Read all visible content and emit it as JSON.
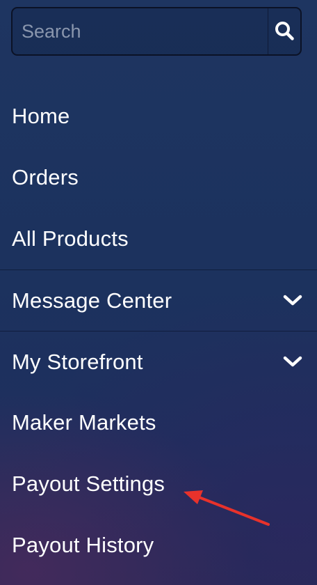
{
  "search": {
    "placeholder": "Search",
    "icon": "search-icon"
  },
  "nav": {
    "items": [
      {
        "label": "Home"
      },
      {
        "label": "Orders"
      },
      {
        "label": "All Products"
      },
      {
        "label": "Message Center",
        "icon": "chevron-down-icon"
      },
      {
        "label": "My Storefront",
        "icon": "chevron-down-icon"
      },
      {
        "label": "Maker Markets"
      },
      {
        "label": "Payout Settings"
      },
      {
        "label": "Payout History"
      }
    ]
  },
  "annotation": {
    "icon": "red-arrow-icon",
    "color": "#e8322b"
  },
  "colors": {
    "background": "#1e3561",
    "text": "#ffffff",
    "placeholder": "#8a96ad"
  }
}
